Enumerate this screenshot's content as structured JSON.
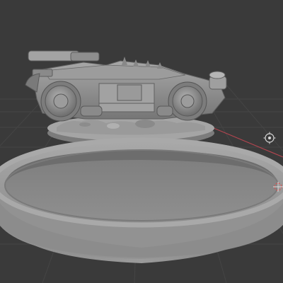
{
  "viewport": {
    "mode": "3d-viewport",
    "background": "#3a3a3a",
    "grid_color": "#454545",
    "x_axis_color": "#b0454f",
    "model_color": "#8e8e8e"
  },
  "scene_objects": [
    {
      "id": "vehicle-model",
      "name": "armored-vehicle-miniature"
    },
    {
      "id": "display-base",
      "name": "round-base-with-terrain"
    },
    {
      "id": "large-base-ring",
      "name": "large-round-base-ring"
    }
  ],
  "icons": {
    "view_gizmo": "view-rotate-gizmo-icon",
    "cursor_3d": "3d-cursor-icon"
  }
}
